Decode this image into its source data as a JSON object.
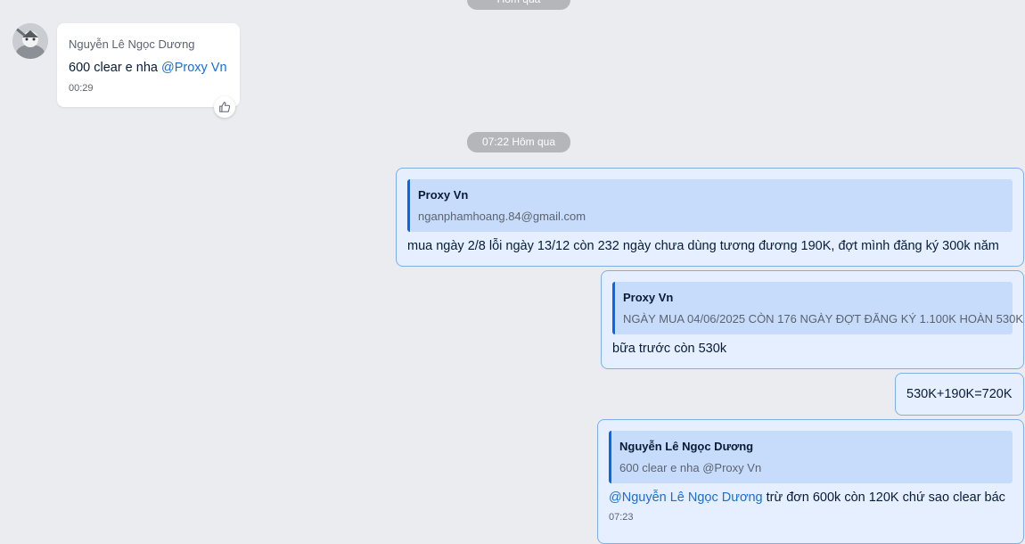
{
  "chat": {
    "separators": [
      "Hôm qua",
      "07:22 Hôm qua"
    ],
    "incoming": {
      "sender": "Nguyễn Lê Ngọc Dương",
      "text": "600 clear e nha ",
      "mention": "@Proxy Vn",
      "time": "00:29",
      "reaction_icon": "thumbs-up-icon"
    },
    "outgoing": [
      {
        "quote_name": "Proxy Vn",
        "quote_text": "nganphamhoang.84@gmail.com",
        "text": "mua ngày 2/8 lỗi ngày 13/12 còn 232 ngày chưa dùng tương đương 190K, đợt mình đăng ký 300k năm"
      },
      {
        "quote_name": "Proxy Vn",
        "quote_text": "NGÀY MUA 04/06/2025 CÒN 176 NGÀY ĐỢT ĐĂNG KÝ 1.100K HOÀN 530K",
        "text": "bữa trước còn 530k"
      },
      {
        "text": "530K+190K=720K"
      },
      {
        "quote_name": "Nguyễn Lê Ngọc Dương",
        "quote_text": "600 clear e nha @Proxy Vn",
        "mention": "@Nguyễn Lê Ngọc Dương",
        "text": " trừ đơn 600k còn 120K chứ sao clear bác",
        "time": "07:23"
      }
    ]
  },
  "colors": {
    "background": "#ebecf0",
    "outgoing_bubble": "#e5efff",
    "quote_background": "#c7dcfb",
    "quote_bar": "#0068ff",
    "mention": "#1b6ed4",
    "separator_pill": "#b4b6ba"
  }
}
